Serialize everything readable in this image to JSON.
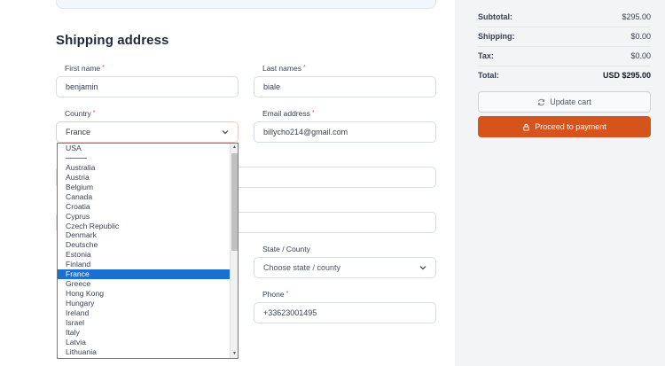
{
  "shipping": {
    "title": "Shipping address",
    "first_name_label": "First name",
    "first_name_value": "benjamin",
    "last_name_label": "Last names",
    "last_name_value": "biale",
    "country_label": "Country",
    "country_value": "France",
    "email_label": "Email address",
    "email_value": "billycho214@gmail.com",
    "state_label": "State / County",
    "state_placeholder": "Choose state / county",
    "phone_label": "Phone",
    "phone_value": "+33623001495",
    "required_mark": "*"
  },
  "country_dropdown": {
    "items": [
      "USA",
      "",
      "Australia",
      "Austria",
      "Belgium",
      "Canada",
      "Croatia",
      "Cyprus",
      "Czech Republic",
      "Denmark",
      "Deutsche",
      "Estonia",
      "Finland",
      "France",
      "Greece",
      "Hong Kong",
      "Hungary",
      "Ireland",
      "Israel",
      "Italy",
      "Latvia",
      "Lithuania"
    ],
    "selected": "France"
  },
  "summary": {
    "subtotal_label": "Subtotal:",
    "subtotal_value": "$295.00",
    "shipping_label": "Shipping:",
    "shipping_value": "$0.00",
    "tax_label": "Tax:",
    "tax_value": "$0.00",
    "total_label": "Total:",
    "total_value": "USD $295.00",
    "update_cart_label": "Update cart",
    "proceed_label": "Proceed to payment"
  },
  "icons": {
    "update": "refresh-icon",
    "pay": "lock-icon",
    "select": "chevron-down-icon"
  },
  "colors": {
    "accent": "#d6531b",
    "selected_option": "#1a6fd0",
    "summary_bg": "#f3f4f6"
  }
}
